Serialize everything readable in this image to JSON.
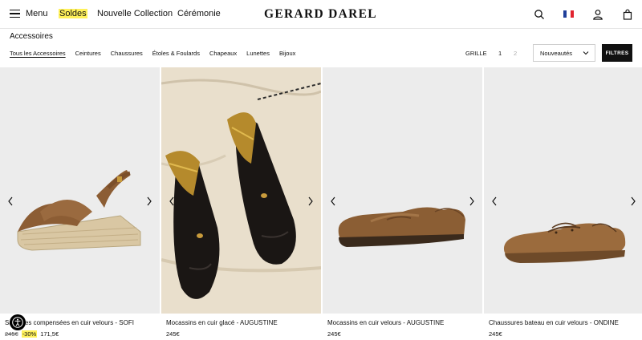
{
  "header": {
    "menu_label": "Menu",
    "nav": [
      {
        "label": "Soldes",
        "highlight": true
      },
      {
        "label": "Nouvelle Collection",
        "highlight": false
      },
      {
        "label": "Cérémonie",
        "highlight": false
      }
    ],
    "logo": "GERARD DAREL",
    "icons": [
      "search-icon",
      "flag-fr-icon",
      "account-icon",
      "bag-icon"
    ],
    "highlight_color": "#fff15a"
  },
  "category": {
    "title": "Accessoires",
    "tabs": [
      "Tous les Accessoires",
      "Ceintures",
      "Chaussures",
      "Étoles & Foulards",
      "Chapeaux",
      "Lunettes",
      "Bijoux"
    ],
    "active_tab": "Tous les Accessoires"
  },
  "toolbar": {
    "grid_label": "GRILLE",
    "grid_options": [
      "1",
      "2"
    ],
    "sort_value": "Nouveautés",
    "filter_label": "FILTRES"
  },
  "products": [
    {
      "name": "Sandales compensées en cuir velours - SOFI",
      "old_price": "245€",
      "discount": "-30%",
      "price": "171,5€"
    },
    {
      "name": "Mocassins en cuir glacé - AUGUSTINE",
      "price": "245€"
    },
    {
      "name": "Mocassins en cuir velours - AUGUSTINE",
      "price": "245€"
    },
    {
      "name": "Chaussures bateau en cuir velours - ONDINE",
      "price": "245€"
    }
  ]
}
